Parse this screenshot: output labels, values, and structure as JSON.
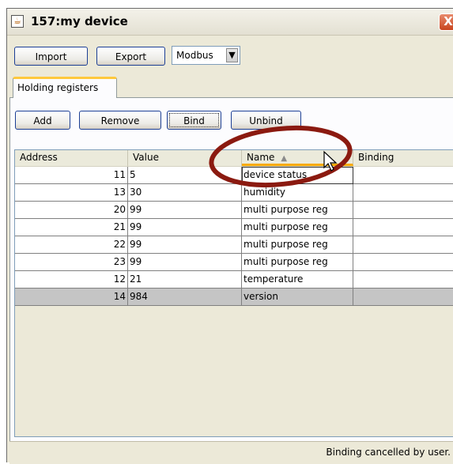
{
  "window": {
    "title": "157:my device",
    "close_glyph": "X",
    "app_icon": "java-cup-icon"
  },
  "toolbar": {
    "import_label": "Import",
    "export_label": "Export",
    "protocol_value": "Modbus",
    "combo_arrow": "▼"
  },
  "tabs": [
    {
      "label": "Holding registers",
      "selected": true
    }
  ],
  "actions": {
    "add_label": "Add",
    "remove_label": "Remove",
    "bind_label": "Bind",
    "unbind_label": "Unbind"
  },
  "table": {
    "columns": [
      "Address",
      "Value",
      "Name",
      "Binding"
    ],
    "sorted_column": "Name",
    "sort_glyph": "▲",
    "rows": [
      {
        "address": "11",
        "value": "5",
        "name": "device status",
        "binding": ""
      },
      {
        "address": "13",
        "value": "30",
        "name": "humidity",
        "binding": ""
      },
      {
        "address": "20",
        "value": "99",
        "name": "multi purpose reg",
        "binding": ""
      },
      {
        "address": "21",
        "value": "99",
        "name": "multi purpose reg",
        "binding": ""
      },
      {
        "address": "22",
        "value": "99",
        "name": "multi purpose reg",
        "binding": ""
      },
      {
        "address": "23",
        "value": "99",
        "name": "multi purpose reg",
        "binding": ""
      },
      {
        "address": "12",
        "value": "21",
        "name": "temperature",
        "binding": ""
      },
      {
        "address": "14",
        "value": "984",
        "name": "version",
        "binding": ""
      }
    ],
    "selected_row": 7
  },
  "status": {
    "message": "Binding cancelled by user."
  },
  "colors": {
    "annotation_ellipse": "#8b1a10",
    "sort_underline": "#f8a900",
    "selected_row": "#c5c5c5"
  }
}
